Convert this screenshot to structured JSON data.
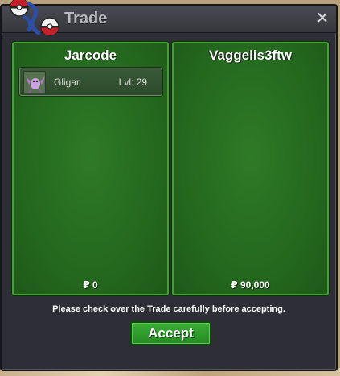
{
  "window": {
    "title": "Trade",
    "close_icon": "close-icon"
  },
  "colors": {
    "window_bg": "#2e2e36",
    "panel_green": "#256a1f",
    "panel_border": "#3fa52f",
    "accept_green": "#2f9c2b"
  },
  "left_panel": {
    "player_name": "Jarcode",
    "pokemon": [
      {
        "icon": "gligar-icon",
        "name": "Gligar",
        "level": "Lvl: 29"
      }
    ],
    "money": "₽ 0"
  },
  "right_panel": {
    "player_name": "Vaggelis3ftw",
    "pokemon": [],
    "money": "₽ 90,000"
  },
  "notice": "Please check over the Trade carefully before accepting.",
  "accept_label": "Accept"
}
